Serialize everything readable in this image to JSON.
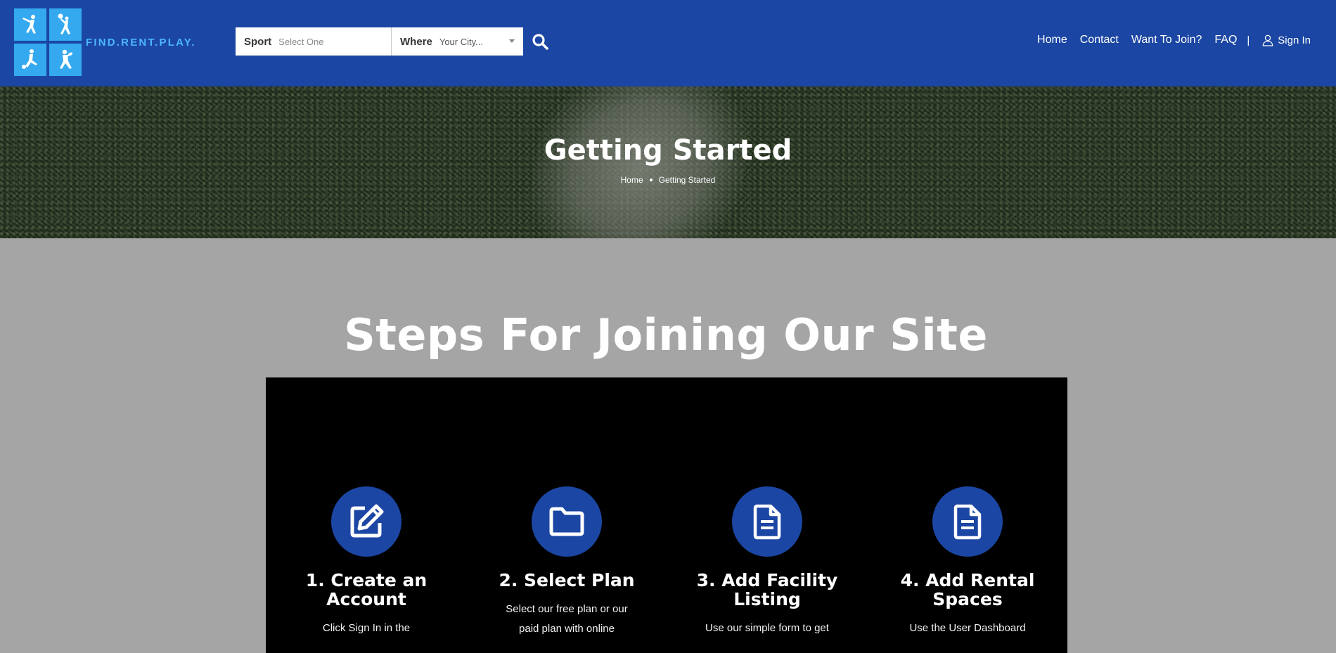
{
  "brand": {
    "name": "FIND.RENT.PLAY."
  },
  "search": {
    "sport_label": "Sport",
    "sport_value": "Select One",
    "where_label": "Where",
    "where_value": "Your City..."
  },
  "nav": {
    "items": [
      "Home",
      "Contact",
      "Want To Join?",
      "FAQ"
    ],
    "separator": "|",
    "sign_in": "Sign In"
  },
  "hero": {
    "title": "Getting Started",
    "breadcrumb": [
      "Home",
      "Getting Started"
    ]
  },
  "steps_section": {
    "title": "Steps For Joining Our Site",
    "steps": [
      {
        "title_line1": "1. Create an",
        "title_line2": "Account",
        "desc_line1": "Click Sign In in the",
        "icon": "edit-icon"
      },
      {
        "title_line1": "2. Select Plan",
        "title_line2": "",
        "desc_line1": "Select our free plan or our",
        "desc_line2": "paid plan with online",
        "icon": "folder-icon"
      },
      {
        "title_line1": "3. Add Facility",
        "title_line2": "Listing",
        "desc_line1": "Use our simple form to get",
        "icon": "document-icon"
      },
      {
        "title_line1": "4. Add Rental",
        "title_line2": "Spaces",
        "desc_line1": "Use the User Dashboard",
        "icon": "document-icon"
      }
    ]
  },
  "colors": {
    "header_bg": "#1b46a3",
    "logo_blue": "#35a9ef",
    "page_bg": "#a5a5a5",
    "panel_bg": "#000000",
    "icon_circle": "#1b46a3"
  }
}
